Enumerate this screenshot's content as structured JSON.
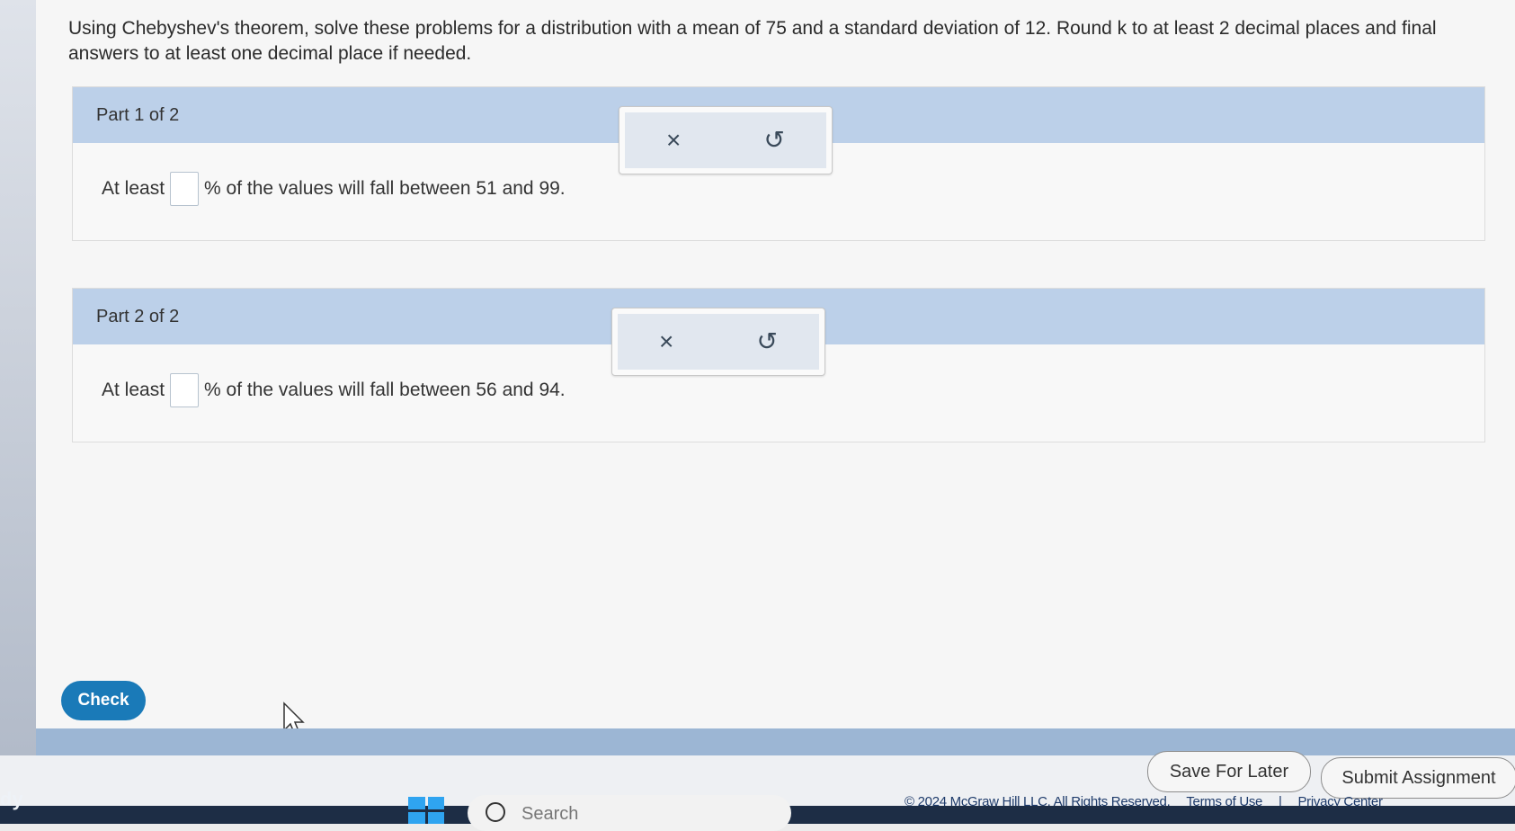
{
  "question": {
    "text": "Using Chebyshev's theorem, solve these problems for a distribution with a mean of 75 and a standard deviation of 12. Round k to at least 2 decimal places and final answers to at least one decimal place if needed."
  },
  "parts": [
    {
      "title": "Part 1 of 2",
      "prefix": "At least",
      "suffix": "% of the values will fall between 51 and 99.",
      "answer_value": ""
    },
    {
      "title": "Part 2 of 2",
      "prefix": "At least",
      "suffix": "% of the values will fall between 56 and 94.",
      "answer_value": ""
    }
  ],
  "tools": {
    "clear_symbol": "×",
    "undo_symbol": "↺",
    "icons": [
      "close-icon",
      "undo-icon"
    ]
  },
  "check_label": "Check",
  "footer": {
    "save_label": "Save For Later",
    "submit_label": "Submit Assignment",
    "copyright": "© 2024 McGraw Hill LLC. All Rights Reserved.",
    "terms": "Terms of Use",
    "separator": "|",
    "privacy": "Privacy Center"
  },
  "taskbar": {
    "left_label": "dy",
    "search_placeholder": "Search"
  },
  "colors": {
    "part_header": "#bcd0e9",
    "check_button": "#1a7ab8",
    "footer_bar": "#9cb6d4"
  }
}
